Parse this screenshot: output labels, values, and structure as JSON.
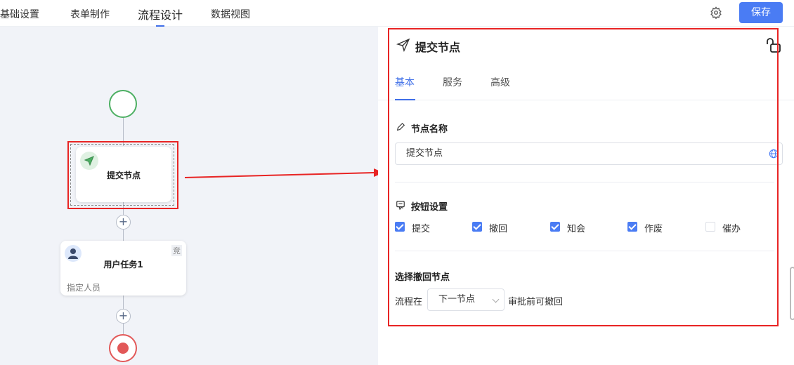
{
  "topbar": {
    "tabs": [
      {
        "label": "基础设置"
      },
      {
        "label": "表单制作"
      },
      {
        "label": "流程设计"
      },
      {
        "label": "数据视图"
      }
    ],
    "active_tab": 2,
    "save_label": "保存"
  },
  "flow": {
    "submit_node": {
      "title": "提交节点"
    },
    "user_task": {
      "title": "用户任务1",
      "badge": "竞",
      "subtitle": "指定人员"
    },
    "plus_symbol": "+"
  },
  "panel": {
    "title": "提交节点",
    "tabs": [
      {
        "label": "基本"
      },
      {
        "label": "服务"
      },
      {
        "label": "高级"
      }
    ],
    "active_tab": 0,
    "node_name_section": "节点名称",
    "node_name_value": "提交节点",
    "button_section": "按钮设置",
    "buttons": [
      {
        "label": "提交",
        "checked": true
      },
      {
        "label": "撤回",
        "checked": true
      },
      {
        "label": "知会",
        "checked": true
      },
      {
        "label": "作废",
        "checked": true
      },
      {
        "label": "催办",
        "checked": false
      }
    ],
    "withdraw_section": "选择撤回节点",
    "withdraw_prefix": "流程在",
    "withdraw_select": "下一节点",
    "withdraw_suffix": "审批前可撤回"
  },
  "colors": {
    "accent": "#4a7cf4",
    "highlight": "#e82424",
    "start": "#4caf62",
    "end": "#e25858"
  }
}
